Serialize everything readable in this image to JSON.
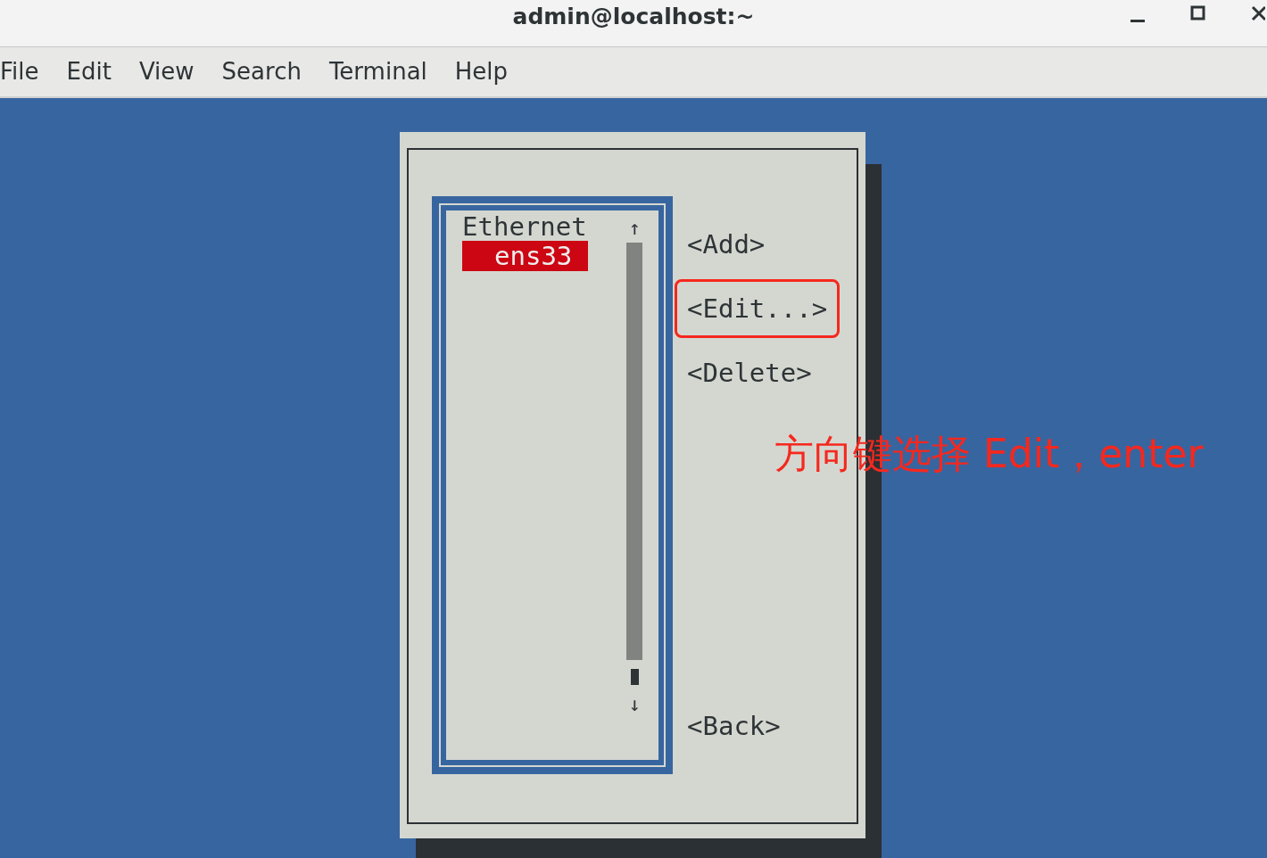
{
  "window": {
    "title": "admin@localhost:~"
  },
  "menu": [
    "File",
    "Edit",
    "View",
    "Search",
    "Terminal",
    "Help"
  ],
  "dialog": {
    "list": {
      "header": "Ethernet",
      "scroll_up": "↑",
      "scroll_down": "↓",
      "items": [
        {
          "label": "ens33",
          "selected": true
        }
      ]
    },
    "buttons": [
      {
        "label": "<Add>",
        "highlighted": false
      },
      {
        "label": "<Edit...>",
        "highlighted": true
      },
      {
        "label": "<Delete>",
        "highlighted": false
      },
      {
        "label": "<Back>",
        "highlighted": false
      }
    ]
  },
  "annotation": {
    "text": "方向键选择 Edit，enter"
  }
}
